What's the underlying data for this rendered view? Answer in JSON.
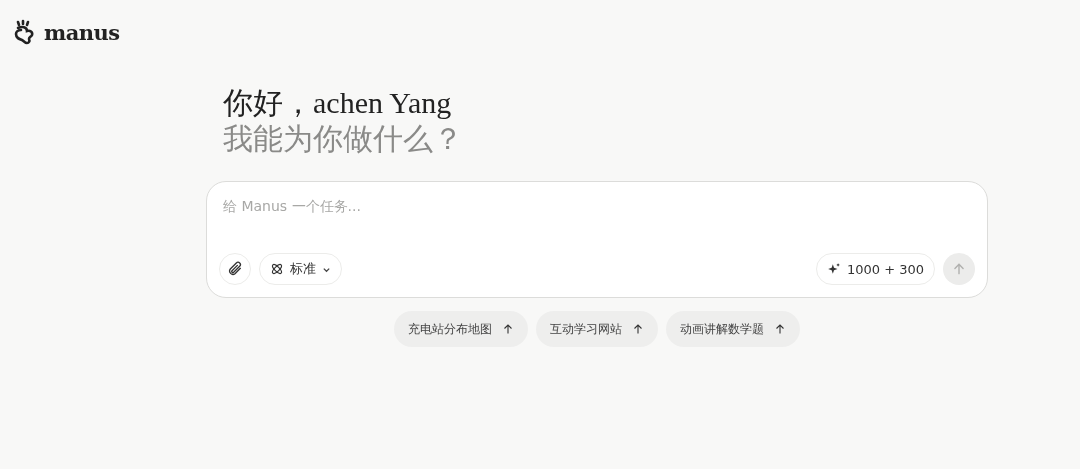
{
  "brand": {
    "name": "manus"
  },
  "greeting": {
    "line_1": "你好，achen Yang",
    "line_2": "我能为你做什么？"
  },
  "composer": {
    "placeholder": "给 Manus 一个任务...",
    "mode": {
      "label": "标准"
    },
    "credits": "1000 + 300",
    "send_disabled": true
  },
  "suggestions": [
    {
      "label": "充电站分布地图"
    },
    {
      "label": "互动学习网站"
    },
    {
      "label": "动画讲解数学题"
    }
  ]
}
